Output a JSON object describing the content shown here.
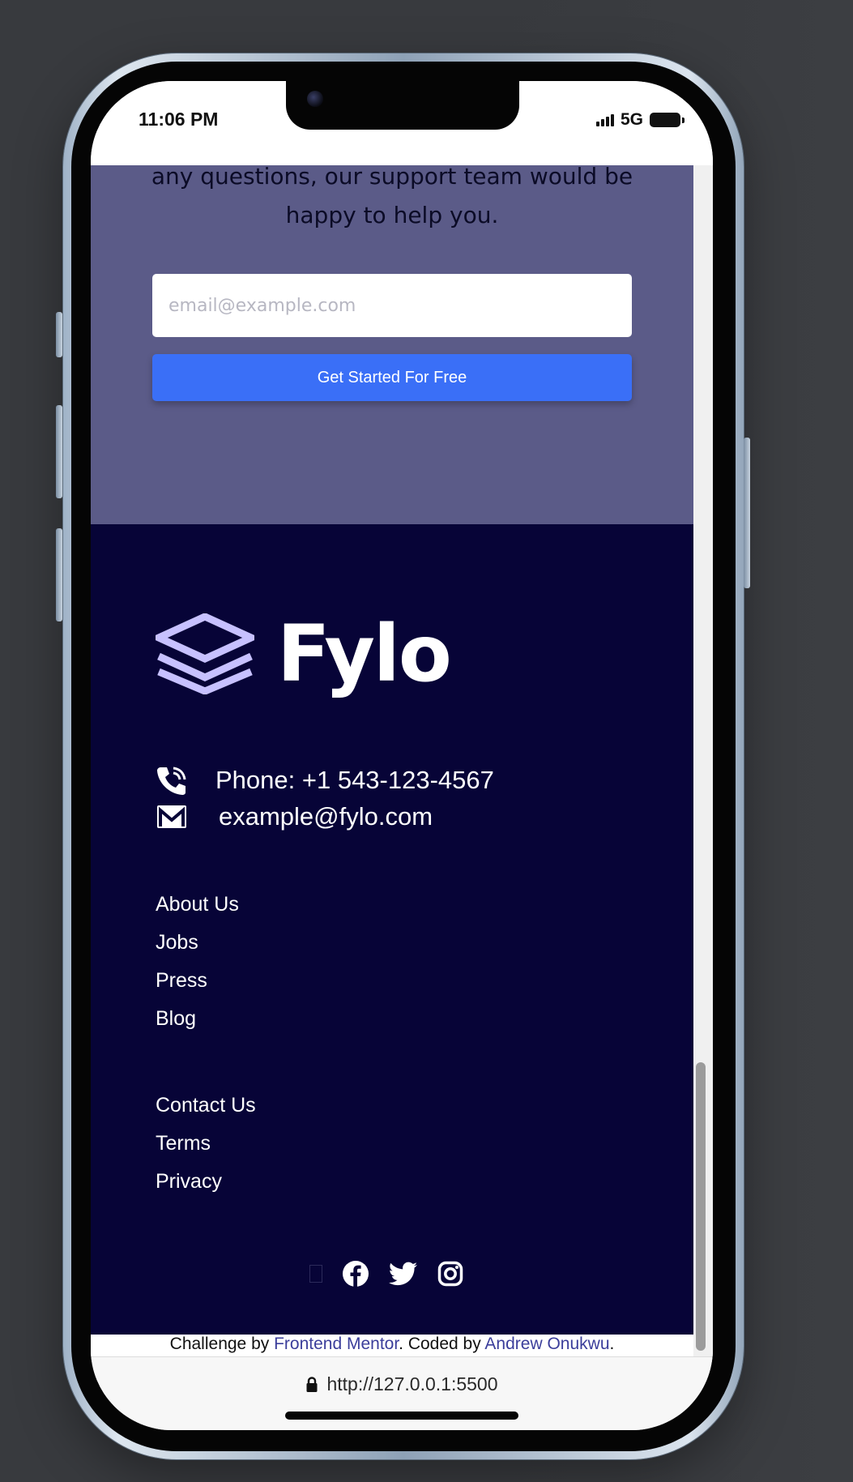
{
  "status_bar": {
    "time": "11:06 PM",
    "network": "5G"
  },
  "cta": {
    "text_line1": "any questions, our support team would be",
    "text_line2": "happy to help you.",
    "email_placeholder": "email@example.com",
    "button_label": "Get Started For Free"
  },
  "footer": {
    "logo_text": "Fylo",
    "phone": "Phone: +1 543-123-4567",
    "email": "example@fylo.com",
    "links_primary": [
      "About Us",
      "Jobs",
      "Press",
      "Blog"
    ],
    "links_secondary": [
      "Contact Us",
      "Terms",
      "Privacy"
    ],
    "social": [
      "facebook-icon",
      "twitter-icon",
      "instagram-icon"
    ]
  },
  "attribution": {
    "prefix": "Challenge by ",
    "challenge_link": "Frontend Mentor",
    "middle": ". Coded by ",
    "author_link": "Andrew Onukwu",
    "suffix": "."
  },
  "browser": {
    "url": "http://127.0.0.1:5500"
  },
  "colors": {
    "cta_background": "#5b5b88",
    "footer_background": "#070437",
    "button_blue": "#3a6ff7",
    "logo_accent": "#c7c1ff",
    "link_blue": "#3b3e9b"
  }
}
